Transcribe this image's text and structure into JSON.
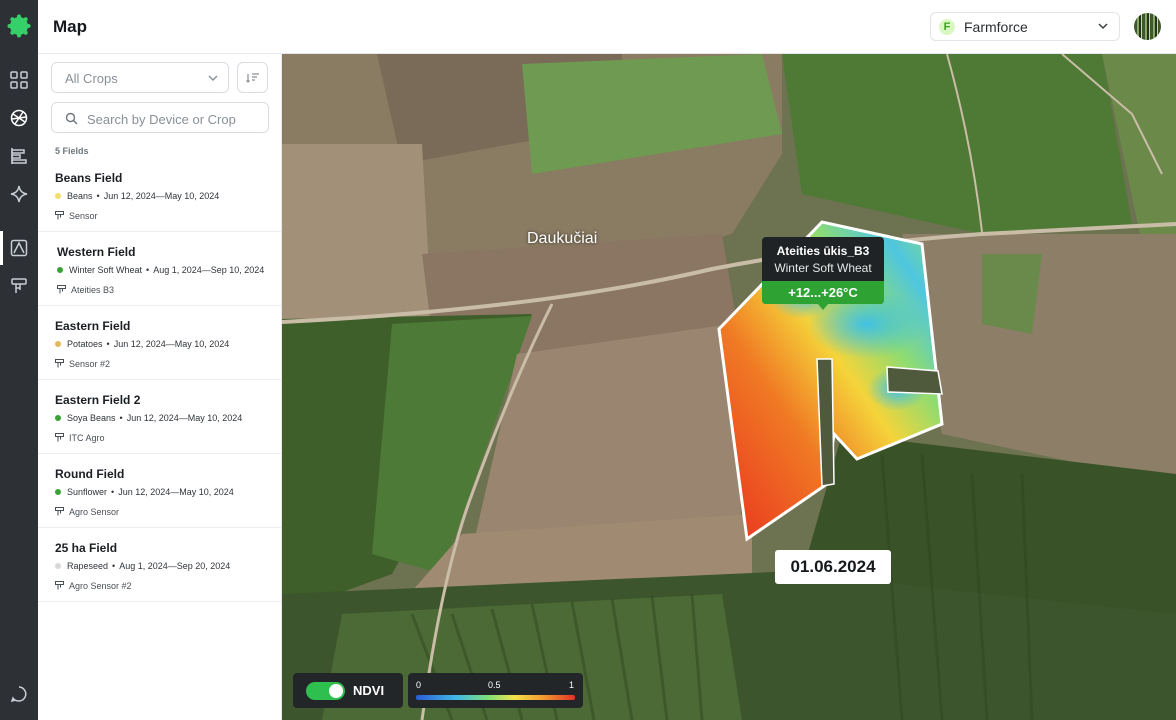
{
  "header": {
    "title": "Map",
    "org": {
      "initial": "F",
      "name": "Farmforce"
    }
  },
  "sidebar": {
    "filter_value": "All Crops",
    "search_placeholder": "Search by Device or Crop",
    "count": "5 Fields",
    "fields": [
      {
        "name": "Beans Field",
        "crop": "Beans",
        "dates": "Jun 12, 2024—May 10, 2024",
        "device": "Sensor",
        "color": "#f2dd6e"
      },
      {
        "name": "Western Field",
        "crop": "Winter Soft Wheat",
        "dates": "Aug  1, 2024—Sep 10, 2024",
        "device": "Ateities B3",
        "color": "#3aa335"
      },
      {
        "name": "Eastern Field",
        "crop": "Potatoes",
        "dates": "Jun 12, 2024—May 10, 2024",
        "device": "Sensor #2",
        "color": "#e3b95b"
      },
      {
        "name": "Eastern Field 2",
        "crop": "Soya Beans",
        "dates": "Jun 12, 2024—May 10, 2024",
        "device": "ITC Agro",
        "color": "#3aa335"
      },
      {
        "name": "Round Field",
        "crop": "Sunflower",
        "dates": "Jun 12, 2024—May 10, 2024",
        "device": "Agro Sensor",
        "color": "#3aa335"
      },
      {
        "name": "25 ha Field",
        "crop": "Rapeseed",
        "dates": "Aug  1, 2024—Sep 20, 2024",
        "device": "Agro Sensor #2",
        "color": "#d6d8da"
      }
    ]
  },
  "map": {
    "place_label": "Daukučiai",
    "tooltip": {
      "farm": "Ateities ūkis_B3",
      "crop": "Winter Soft Wheat",
      "temp": "+12...+26°C"
    },
    "date": "01.06.2024",
    "ndvi_label": "NDVI",
    "ndvi_enabled": true,
    "scale": {
      "min": "0",
      "mid": "0.5",
      "max": "1"
    }
  }
}
